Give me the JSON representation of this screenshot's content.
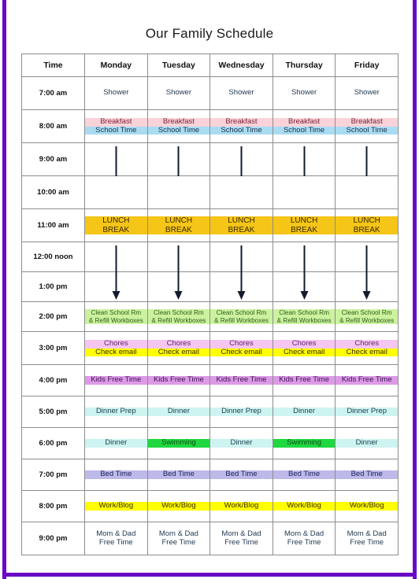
{
  "page": {
    "title": "Our Family Schedule",
    "border_color": "#6a08c4",
    "background": "#ffffff"
  },
  "table": {
    "columns": [
      "Time",
      "Monday",
      "Tuesday",
      "Wednesday",
      "Thursday",
      "Friday"
    ],
    "time_label_header": "Time",
    "days": [
      "Monday",
      "Tuesday",
      "Wednesday",
      "Thursday",
      "Friday"
    ],
    "times": [
      "7:00 am",
      "8:00 am",
      "9:00 am",
      "10:00 am",
      "11:00 am",
      "12:00 noon",
      "1:00 pm",
      "2:00 pm",
      "3:00 pm",
      "4:00 pm",
      "5:00 pm",
      "6:00 pm",
      "7:00 pm",
      "8:00 pm",
      "9:00 pm"
    ]
  },
  "colors": {
    "breakfast": "#f9d3d9",
    "school_time": "#a9dcf2",
    "lunch_break": "#f5c518",
    "clean_school": "#ccf2a0",
    "chores": "#f5c6ef",
    "check_email": "#ffff00",
    "kids_free_time": "#dc9ae6",
    "dinner": "#cdf4f0",
    "swimming": "#1fd83f",
    "bed_time": "#bdb9e8",
    "work_blog": "#ffff00",
    "free_time": "#ffffff",
    "shower": "#ffffff",
    "arrow": "#111c2e",
    "grid_line": "#8d8d8d"
  },
  "labels": {
    "shower": "Shower",
    "breakfast": "Breakfast",
    "school_time": "School Time",
    "lunch_break_line1": "LUNCH",
    "lunch_break_line2": "BREAK",
    "clean_line1": "Clean School Rm",
    "clean_line2": "& Refill Workboxes",
    "chores": "Chores",
    "check_email": "Check email",
    "kids_free_time": "Kids Free Time",
    "dinner_prep": "Dinner Prep",
    "dinner": "Dinner",
    "swimming": "Swimming",
    "bed_time": "Bed Time",
    "work_blog": "Work/Blog",
    "free_line1": "Mom & Dad",
    "free_line2": "Free Time"
  },
  "rows": [
    {
      "time": "7:00 am",
      "cells": [
        {
          "text": "Shower",
          "kind": "shower"
        },
        {
          "text": "Shower",
          "kind": "shower"
        },
        {
          "text": "Shower",
          "kind": "shower"
        },
        {
          "text": "Shower",
          "kind": "shower"
        },
        {
          "text": "Shower",
          "kind": "shower"
        }
      ]
    },
    {
      "time": "8:00 am",
      "cells": [
        {
          "text": "Breakfast / School Time",
          "kind": "breakfast-school"
        },
        {
          "text": "Breakfast / School Time",
          "kind": "breakfast-school"
        },
        {
          "text": "Breakfast / School Time",
          "kind": "breakfast-school"
        },
        {
          "text": "Breakfast / School Time",
          "kind": "breakfast-school"
        },
        {
          "text": "Breakfast / School Time",
          "kind": "breakfast-school"
        }
      ]
    },
    {
      "time": "9:00 am",
      "cells": [
        {
          "text": "",
          "kind": "school-continue"
        },
        {
          "text": "",
          "kind": "school-continue"
        },
        {
          "text": "",
          "kind": "school-continue"
        },
        {
          "text": "",
          "kind": "school-continue"
        },
        {
          "text": "",
          "kind": "school-continue"
        }
      ]
    },
    {
      "time": "10:00 am",
      "cells": [
        {
          "text": "",
          "kind": "school-continue"
        },
        {
          "text": "",
          "kind": "school-continue"
        },
        {
          "text": "",
          "kind": "school-continue"
        },
        {
          "text": "",
          "kind": "school-continue"
        },
        {
          "text": "",
          "kind": "school-continue"
        }
      ]
    },
    {
      "time": "11:00 am",
      "cells": [
        {
          "text": "LUNCH BREAK",
          "kind": "lunch"
        },
        {
          "text": "LUNCH BREAK",
          "kind": "lunch"
        },
        {
          "text": "LUNCH BREAK",
          "kind": "lunch"
        },
        {
          "text": "LUNCH BREAK",
          "kind": "lunch"
        },
        {
          "text": "LUNCH BREAK",
          "kind": "lunch"
        }
      ]
    },
    {
      "time": "12:00 noon",
      "cells": [
        {
          "text": "",
          "kind": "lunch-tail-school"
        },
        {
          "text": "",
          "kind": "lunch-tail-school"
        },
        {
          "text": "",
          "kind": "lunch-tail-school"
        },
        {
          "text": "",
          "kind": "lunch-tail-school"
        },
        {
          "text": "",
          "kind": "lunch-tail-school"
        }
      ]
    },
    {
      "time": "1:00 pm",
      "cells": [
        {
          "text": "",
          "kind": "school-continue"
        },
        {
          "text": "",
          "kind": "school-continue"
        },
        {
          "text": "",
          "kind": "school-continue"
        },
        {
          "text": "",
          "kind": "school-continue"
        },
        {
          "text": "",
          "kind": "school-continue"
        }
      ]
    },
    {
      "time": "2:00 pm",
      "cells": [
        {
          "text": "Clean School Rm & Refill Workboxes",
          "kind": "clean"
        },
        {
          "text": "Clean School Rm & Refill Workboxes",
          "kind": "clean"
        },
        {
          "text": "Clean School Rm & Refill Workboxes",
          "kind": "clean"
        },
        {
          "text": "Clean School Rm & Refill Workboxes",
          "kind": "clean"
        },
        {
          "text": "Clean School Rm & Refill Workboxes",
          "kind": "clean"
        }
      ]
    },
    {
      "time": "3:00 pm",
      "cells": [
        {
          "text": "Chores / Check email",
          "kind": "chores-email"
        },
        {
          "text": "Chores / Check email",
          "kind": "chores-email"
        },
        {
          "text": "Chores / Check email",
          "kind": "chores-email"
        },
        {
          "text": "Chores / Check email",
          "kind": "chores-email"
        },
        {
          "text": "Chores / Check email",
          "kind": "chores-email"
        }
      ]
    },
    {
      "time": "4:00 pm",
      "cells": [
        {
          "text": "Kids Free Time",
          "kind": "kids"
        },
        {
          "text": "Kids Free Time",
          "kind": "kids"
        },
        {
          "text": "Kids Free Time",
          "kind": "kids"
        },
        {
          "text": "Kids Free Time",
          "kind": "kids"
        },
        {
          "text": "Kids Free Time",
          "kind": "kids"
        }
      ]
    },
    {
      "time": "5:00 pm",
      "cells": [
        {
          "text": "Dinner Prep",
          "kind": "dinner"
        },
        {
          "text": "Dinner",
          "kind": "dinner"
        },
        {
          "text": "Dinner Prep",
          "kind": "dinner"
        },
        {
          "text": "Dinner",
          "kind": "dinner"
        },
        {
          "text": "Dinner Prep",
          "kind": "dinner"
        }
      ]
    },
    {
      "time": "6:00 pm",
      "cells": [
        {
          "text": "Dinner",
          "kind": "dinner"
        },
        {
          "text": "Swimming",
          "kind": "swimming"
        },
        {
          "text": "Dinner",
          "kind": "dinner"
        },
        {
          "text": "Swimming",
          "kind": "swimming"
        },
        {
          "text": "Dinner",
          "kind": "dinner"
        }
      ]
    },
    {
      "time": "7:00 pm",
      "cells": [
        {
          "text": "Bed Time",
          "kind": "bed"
        },
        {
          "text": "Bed Time",
          "kind": "bed"
        },
        {
          "text": "Bed Time",
          "kind": "bed"
        },
        {
          "text": "Bed Time",
          "kind": "bed"
        },
        {
          "text": "Bed Time",
          "kind": "bed"
        }
      ]
    },
    {
      "time": "8:00 pm",
      "cells": [
        {
          "text": "Work/Blog",
          "kind": "work"
        },
        {
          "text": "Work/Blog",
          "kind": "work"
        },
        {
          "text": "Work/Blog",
          "kind": "work"
        },
        {
          "text": "Work/Blog",
          "kind": "work"
        },
        {
          "text": "Work/Blog",
          "kind": "work"
        }
      ]
    },
    {
      "time": "9:00 pm",
      "cells": [
        {
          "text": "Mom & Dad Free Time",
          "kind": "free"
        },
        {
          "text": "Mom & Dad Free Time",
          "kind": "free"
        },
        {
          "text": "Mom & Dad Free Time",
          "kind": "free"
        },
        {
          "text": "Mom & Dad Free Time",
          "kind": "free"
        },
        {
          "text": "Mom & Dad Free Time",
          "kind": "free"
        }
      ]
    }
  ]
}
